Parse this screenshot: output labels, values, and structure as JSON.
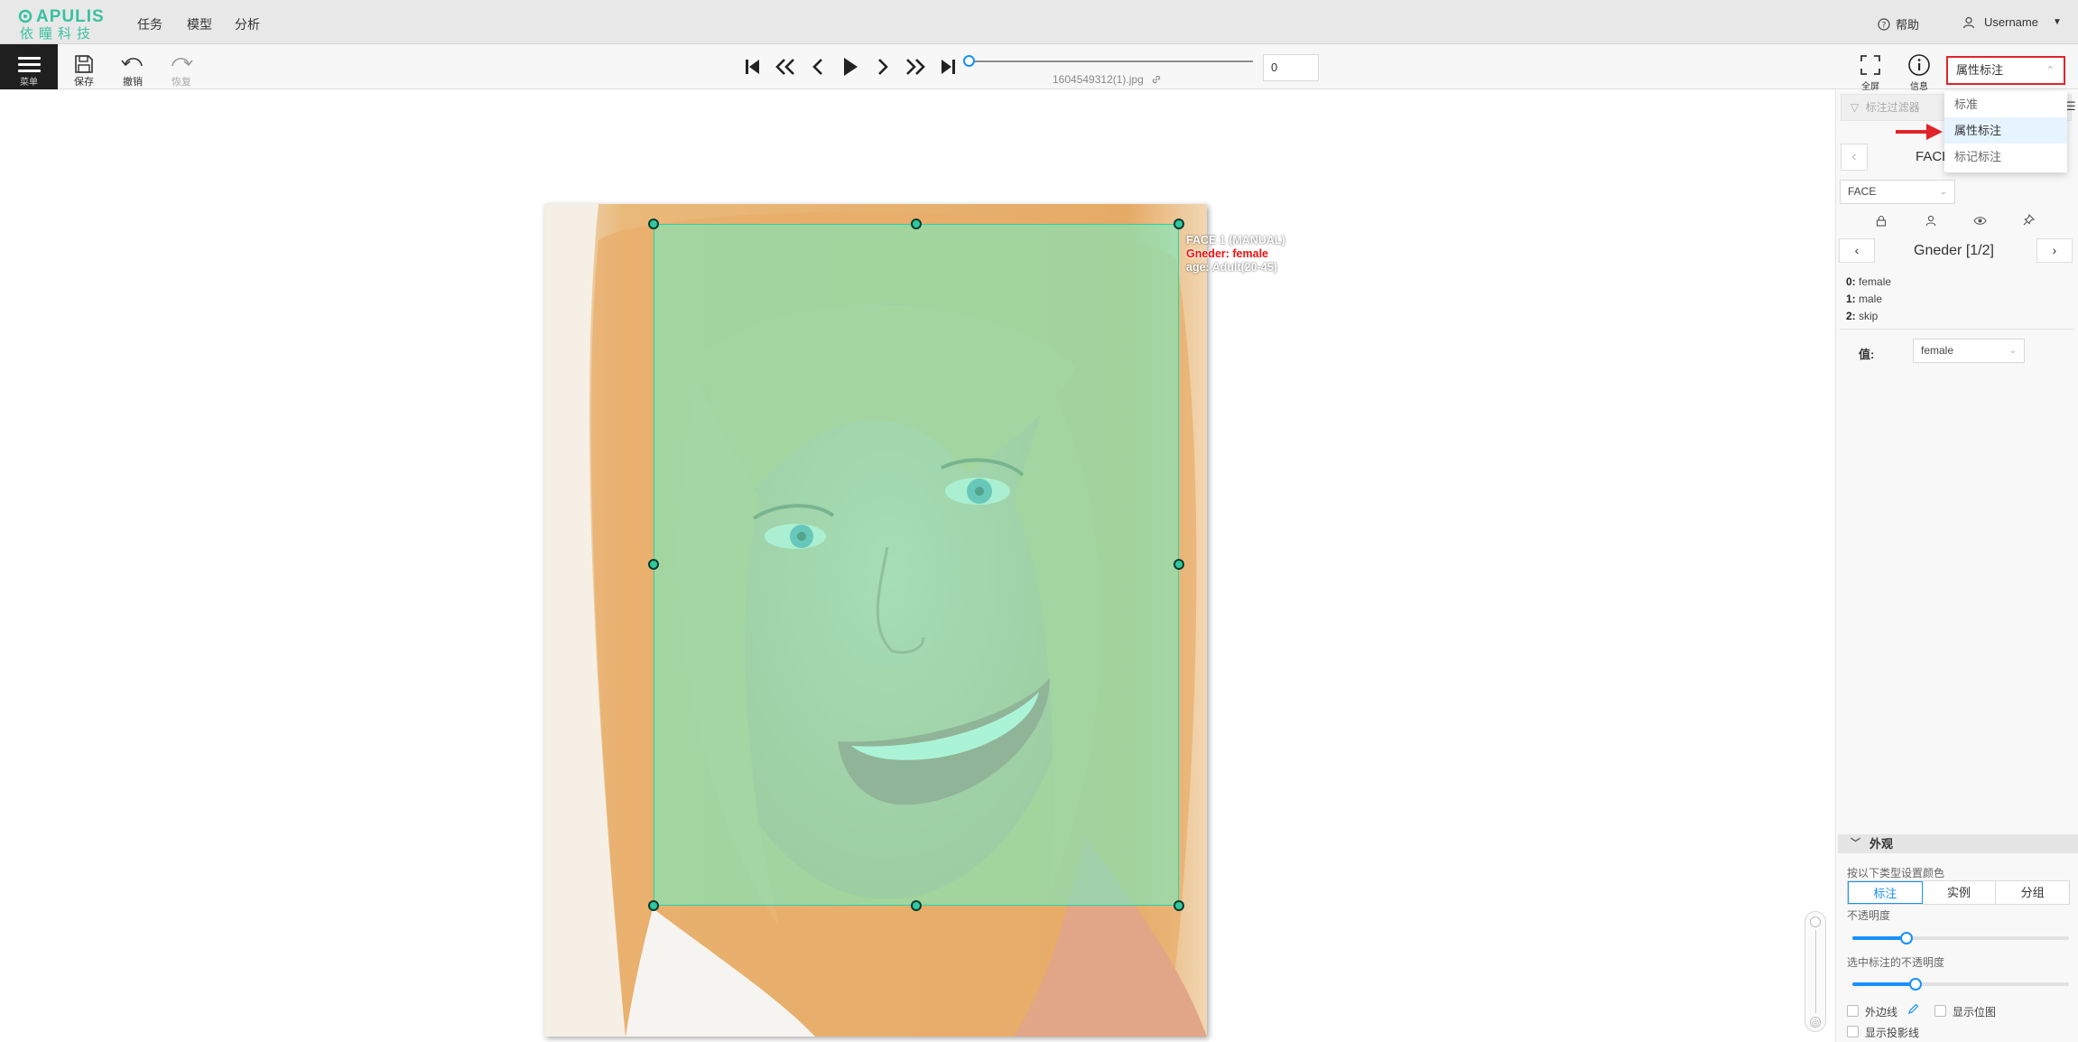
{
  "logo": {
    "brand": "APULIS",
    "sub": "依瞳科技"
  },
  "nav": {
    "items": [
      "任务",
      "模型",
      "分析"
    ],
    "help": "帮助",
    "user": "Username"
  },
  "toolbar": {
    "menu_label": "菜单",
    "save_label": "保存",
    "undo_label": "撤销",
    "redo_label": "恢复",
    "frame_value": "0",
    "filename": "1604549312(1).jpg",
    "fullscreen_label": "全屏",
    "info_label": "信息",
    "frame_progress": 0
  },
  "mode": {
    "selected": "属性标注",
    "options": [
      "标准",
      "属性标注",
      "标记标注"
    ]
  },
  "annotation": {
    "line1": "FACE 1 (MANUAL)",
    "line2": "Gneder: female",
    "line3": "age: Adult(20-45)",
    "color": "#28d4a8"
  },
  "panel": {
    "filter_placeholder": "标注过滤器",
    "face_title": "FACE",
    "label_select": "FACE",
    "attr_title": "Gneder [1/2]",
    "options": [
      {
        "key": "0:",
        "text": "female"
      },
      {
        "key": "1:",
        "text": "male"
      },
      {
        "key": "2:",
        "text": "skip"
      }
    ],
    "value_label": "值:",
    "value_selected": "female",
    "appearance_title": "外观",
    "color_by_label": "按以下类型设置颜色",
    "color_by_options": [
      "标注",
      "实例",
      "分组"
    ],
    "opacity_label": "不透明度",
    "selected_opacity_label": "选中标注的不透明度",
    "opacity_value": 0.25,
    "selected_opacity_value": 0.29,
    "outline_label": "外边线",
    "show_bitmap_label": "显示位图",
    "show_projections_label": "显示投影线"
  },
  "colors": {
    "accent": "#1890ff",
    "brand": "#39c1a0",
    "highlight_border": "#e0242a"
  }
}
